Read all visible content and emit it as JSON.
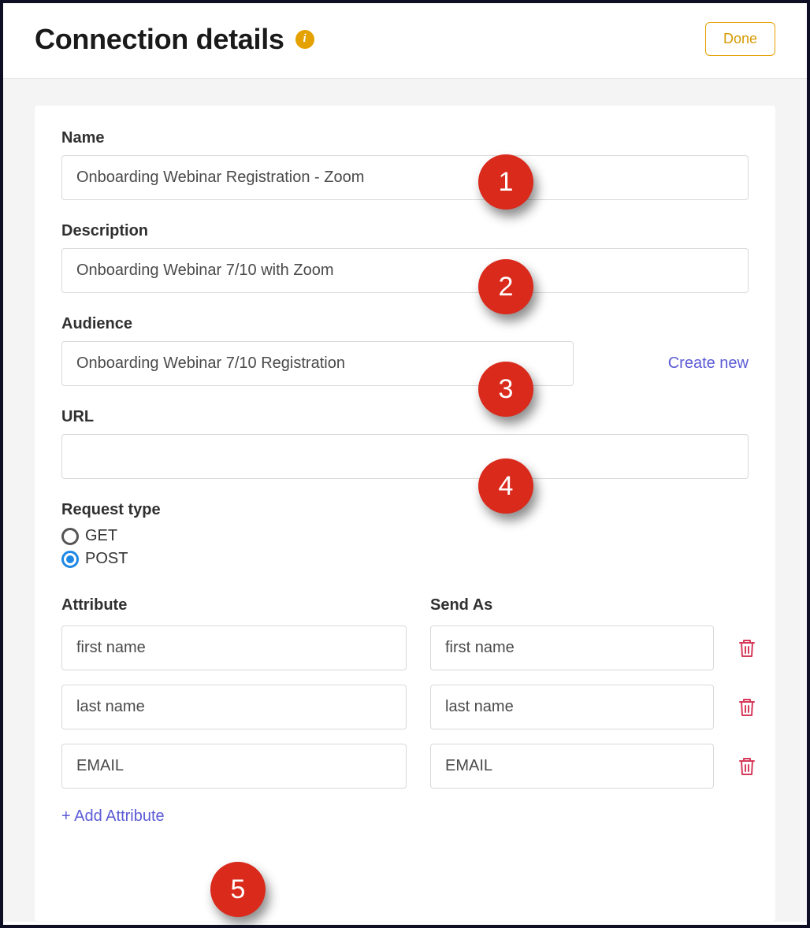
{
  "header": {
    "title": "Connection details",
    "done_label": "Done"
  },
  "form": {
    "name_label": "Name",
    "name_value": "Onboarding Webinar Registration - Zoom",
    "description_label": "Description",
    "description_value": "Onboarding Webinar 7/10 with Zoom",
    "audience_label": "Audience",
    "audience_value": "Onboarding Webinar 7/10 Registration",
    "create_new_label": "Create new",
    "url_label": "URL",
    "url_value": "",
    "request_type_label": "Request type",
    "request_get_label": "GET",
    "request_post_label": "POST",
    "request_selected": "POST",
    "attribute_header": "Attribute",
    "sendas_header": "Send As",
    "attributes": [
      {
        "attr": "first name",
        "sendas": "first name"
      },
      {
        "attr": "last name",
        "sendas": "last name"
      },
      {
        "attr": "EMAIL",
        "sendas": "EMAIL"
      }
    ],
    "add_attribute_label": "+ Add Attribute"
  },
  "callouts": {
    "c1": "1",
    "c2": "2",
    "c3": "3",
    "c4": "4",
    "c5": "5"
  }
}
